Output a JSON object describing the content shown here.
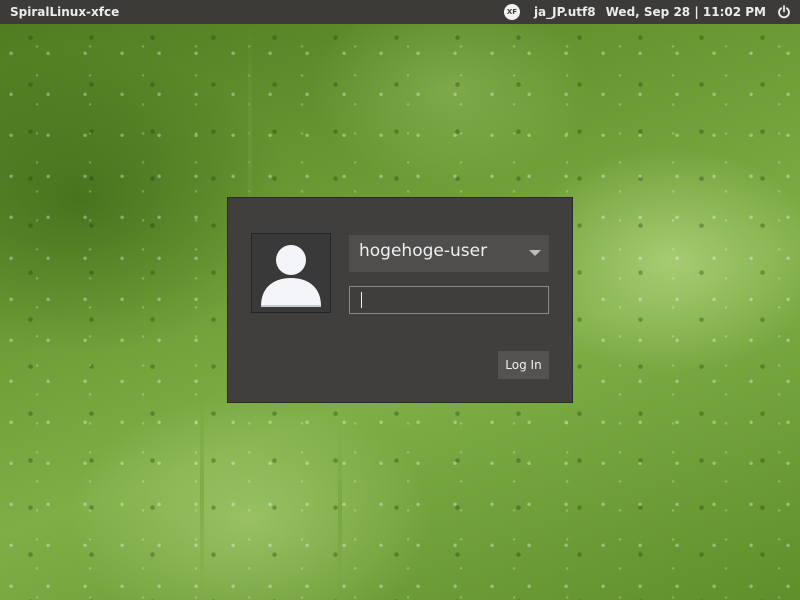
{
  "panel": {
    "hostname": "SpiralLinux-xfce",
    "xf_badge": "XF",
    "locale": "ja_JP.utf8",
    "clock": "Wed, Sep 28 | 11:02 PM",
    "power_icon": "power-icon"
  },
  "login": {
    "avatar_icon": "user-avatar-icon",
    "username": "hogehoge-user",
    "password_value": "",
    "login_button": "Log In"
  },
  "colors": {
    "panel_bg": "#3c3b37",
    "dialog_bg": "#403f3e",
    "wallpaper_accent": "#6b9a34"
  }
}
